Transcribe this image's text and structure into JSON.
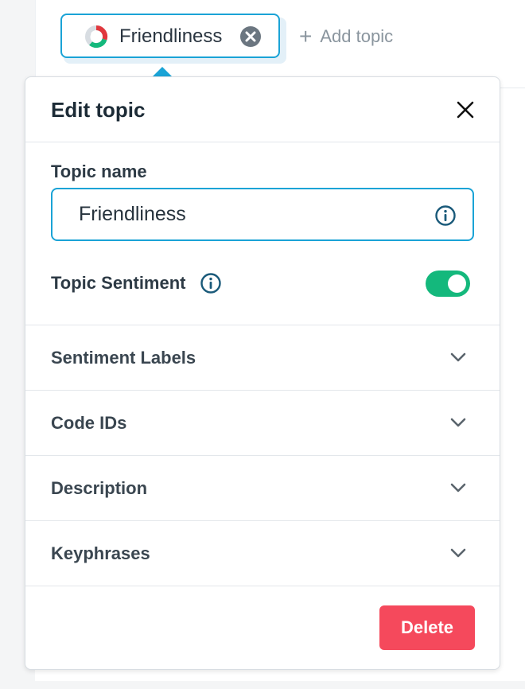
{
  "topic_chip": {
    "label": "Friendliness",
    "icon": "sentiment-donut-icon"
  },
  "add_topic": {
    "label": "Add topic"
  },
  "panel": {
    "title": "Edit topic",
    "topic_name_label": "Topic name",
    "topic_name_value": "Friendliness",
    "sentiment_label": "Topic Sentiment",
    "sentiment_enabled": true,
    "sections": [
      {
        "label": "Sentiment Labels"
      },
      {
        "label": "Code IDs"
      },
      {
        "label": "Description"
      },
      {
        "label": "Keyphrases"
      }
    ],
    "delete_label": "Delete"
  },
  "colors": {
    "accent": "#1aa3d6",
    "toggle_on": "#14b87c",
    "danger": "#f5495c",
    "info_icon": "#1a5a7a"
  }
}
